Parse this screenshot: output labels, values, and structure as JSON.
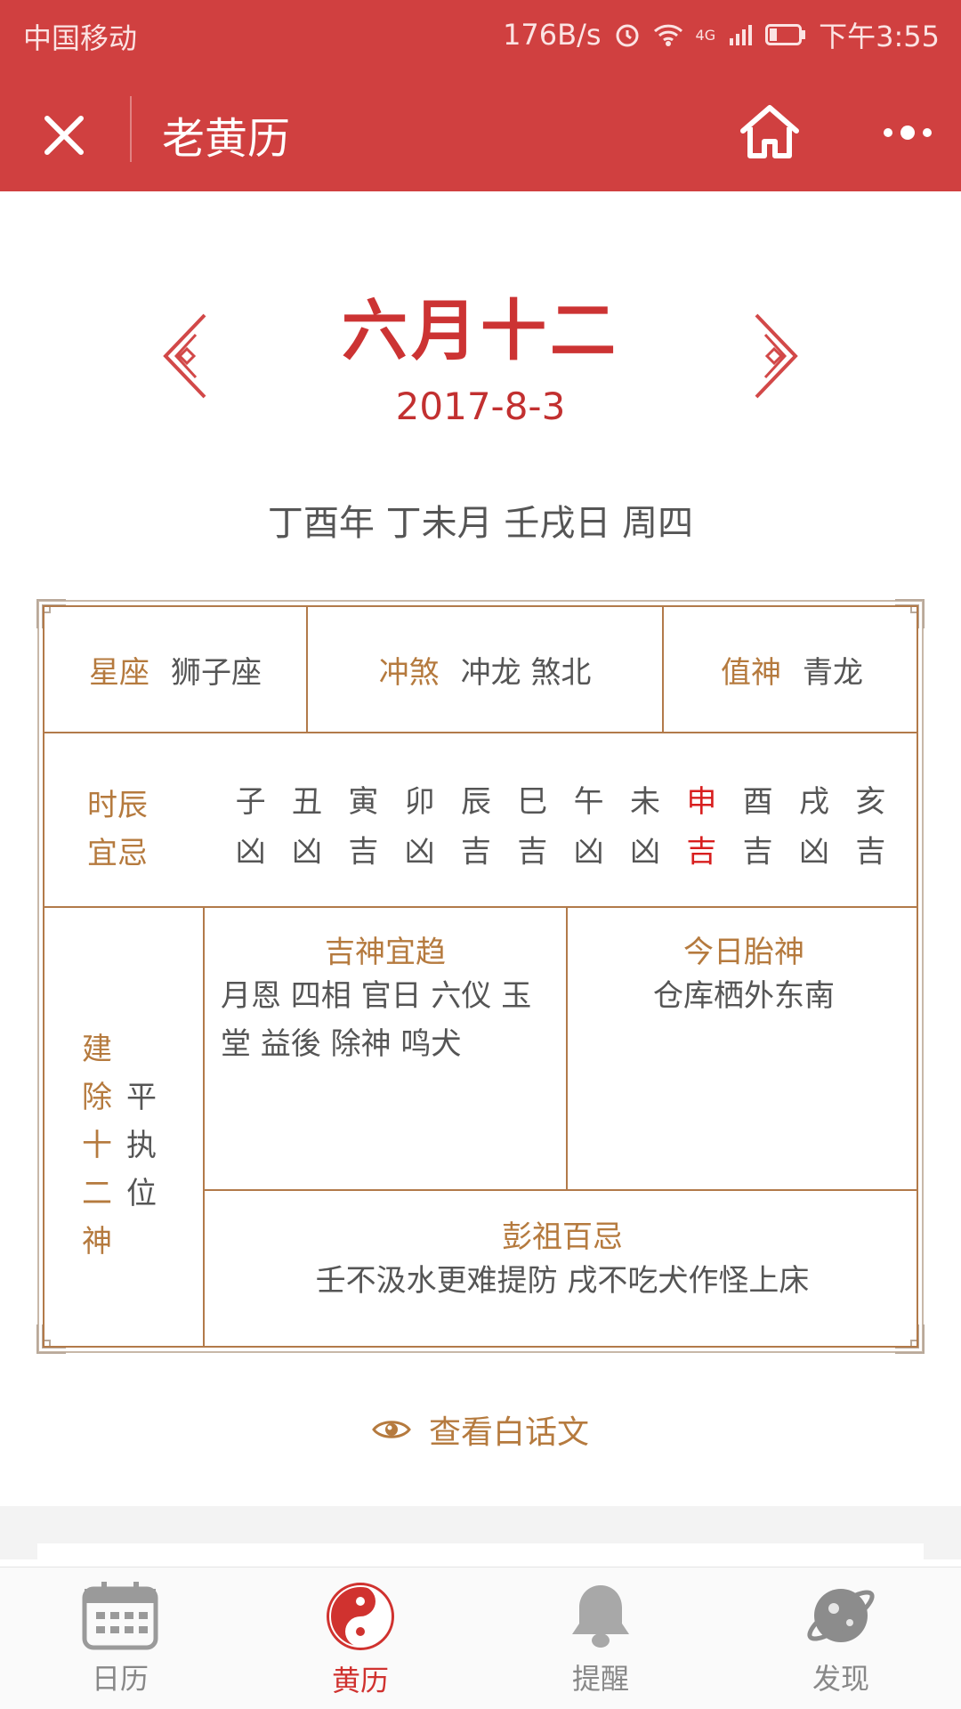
{
  "status_bar": {
    "carrier": "中国移动",
    "speed": "176B/s",
    "network": "4G",
    "time": "下午3:55"
  },
  "header": {
    "title": "老黄历"
  },
  "date": {
    "lunar": "六月十二",
    "solar": "2017-8-3",
    "ganzhi": "丁酉年 丁未月 壬戌日 周四"
  },
  "almanac": {
    "constellation": {
      "label": "星座",
      "value": "狮子座"
    },
    "clash": {
      "label": "冲煞",
      "value": "冲龙 煞北"
    },
    "duty_god": {
      "label": "值神",
      "value": "青龙"
    },
    "hours": {
      "label_line1": "时辰",
      "label_line2": "宜忌",
      "branches": [
        "子",
        "丑",
        "寅",
        "卯",
        "辰",
        "巳",
        "午",
        "未",
        "申",
        "酉",
        "戌",
        "亥"
      ],
      "fortunes": [
        "凶",
        "凶",
        "吉",
        "凶",
        "吉",
        "吉",
        "凶",
        "凶",
        "吉",
        "吉",
        "凶",
        "吉"
      ],
      "highlight_index": 8,
      "highlight_color": "#d81e1e"
    },
    "twelve_gods": {
      "label_chars": [
        "建",
        "除",
        "十",
        "二",
        "神"
      ],
      "value_chars": [
        "平",
        "执",
        "位"
      ]
    },
    "auspicious_gods": {
      "title": "吉神宜趋",
      "text": "月恩 四相 官日 六仪 玉堂 益後 除神 鸣犬"
    },
    "fetal_god": {
      "title": "今日胎神",
      "text": "仓库栖外东南"
    },
    "pengzu": {
      "title": "彭祖百忌",
      "text": "壬不汲水更难提防 戌不吃犬作怪上床"
    }
  },
  "plain_text_link": "查看白话文",
  "tabs": [
    {
      "label": "日历",
      "icon": "calendar-icon"
    },
    {
      "label": "黄历",
      "icon": "yin-yang-icon",
      "active": true
    },
    {
      "label": "提醒",
      "icon": "bell-icon"
    },
    {
      "label": "发现",
      "icon": "planet-icon"
    }
  ],
  "colors": {
    "header_bg": "#d04040",
    "accent_brown": "#b57a3e",
    "lunar_red": "#cc3333"
  }
}
